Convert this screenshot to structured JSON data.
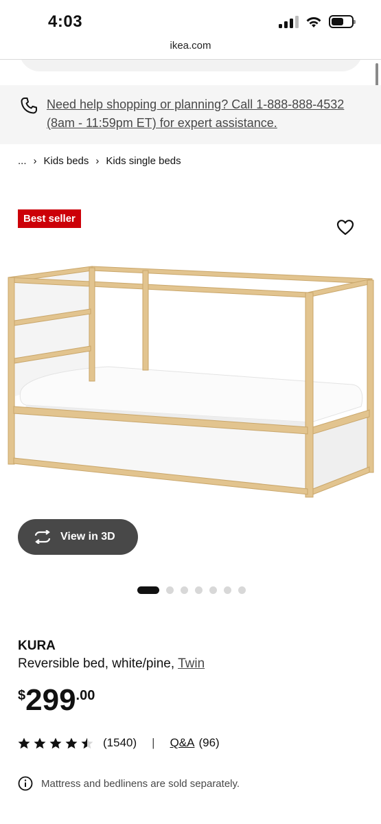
{
  "status_bar": {
    "time": "4:03",
    "icons": [
      "signal-icon",
      "wifi-icon",
      "battery-icon"
    ]
  },
  "browser": {
    "url": "ikea.com"
  },
  "help_banner": {
    "text": "Need help shopping or planning? Call 1-888-888-4532 (8am - 11:59pm ET) for expert assistance.",
    "icon": "phone-icon"
  },
  "breadcrumb": {
    "items": [
      "...",
      "Kids beds",
      "Kids single beds"
    ]
  },
  "badge": {
    "label": "Best seller",
    "color": "#cc0008"
  },
  "view3d": {
    "label": "View in 3D"
  },
  "carousel": {
    "total": 7,
    "active_index": 0
  },
  "product": {
    "name": "KURA",
    "description": "Reversible bed, white/pine,",
    "size": "Twin",
    "price": {
      "currency": "$",
      "integer": "299",
      "decimal": ".00"
    },
    "rating": {
      "value": 4.5,
      "max": 5,
      "count": "(1540)"
    },
    "divider": "|",
    "qa": {
      "label": "Q&A",
      "count": "(96)"
    },
    "notice": "Mattress and bedlinens are sold separately."
  }
}
